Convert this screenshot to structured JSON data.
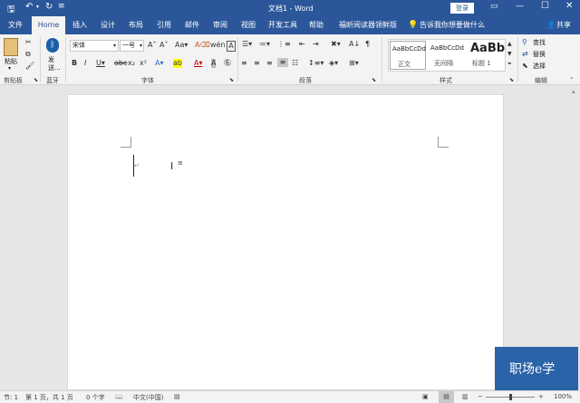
{
  "window": {
    "title": "文档1 - Word",
    "login_label": "登录"
  },
  "tabs": [
    "文件",
    "Home",
    "插入",
    "设计",
    "布局",
    "引用",
    "邮件",
    "审阅",
    "视图",
    "开发工具",
    "帮助",
    "福昕阅读器领鲜版"
  ],
  "tell_me": "告诉我你想要做什么",
  "share": "共享",
  "clipboard": {
    "paste": "粘贴",
    "group": "剪贴板"
  },
  "bluetooth": {
    "send": "发送...",
    "group": "蓝牙"
  },
  "font": {
    "name": "宋体",
    "size": "一号",
    "group": "字体"
  },
  "paragraph": {
    "group": "段落"
  },
  "styles": {
    "group": "样式",
    "items": [
      {
        "preview": "AaBbCcDd",
        "name": "正文"
      },
      {
        "preview": "AaBbCcDd",
        "name": "无间隔"
      },
      {
        "preview": "AaBb",
        "name": "标题 1"
      }
    ]
  },
  "editing": {
    "find": "查找",
    "replace": "替换",
    "select": "选择",
    "group": "编辑"
  },
  "status": {
    "section": "节: 1",
    "page": "第 1 页，共 1 页",
    "words": "0 个字",
    "language": "中文(中国)",
    "zoom": "100%"
  },
  "watermark": {
    "text": "职场e学"
  },
  "colors": {
    "brand": "#2b579a",
    "accent_e": "#e8842a"
  }
}
